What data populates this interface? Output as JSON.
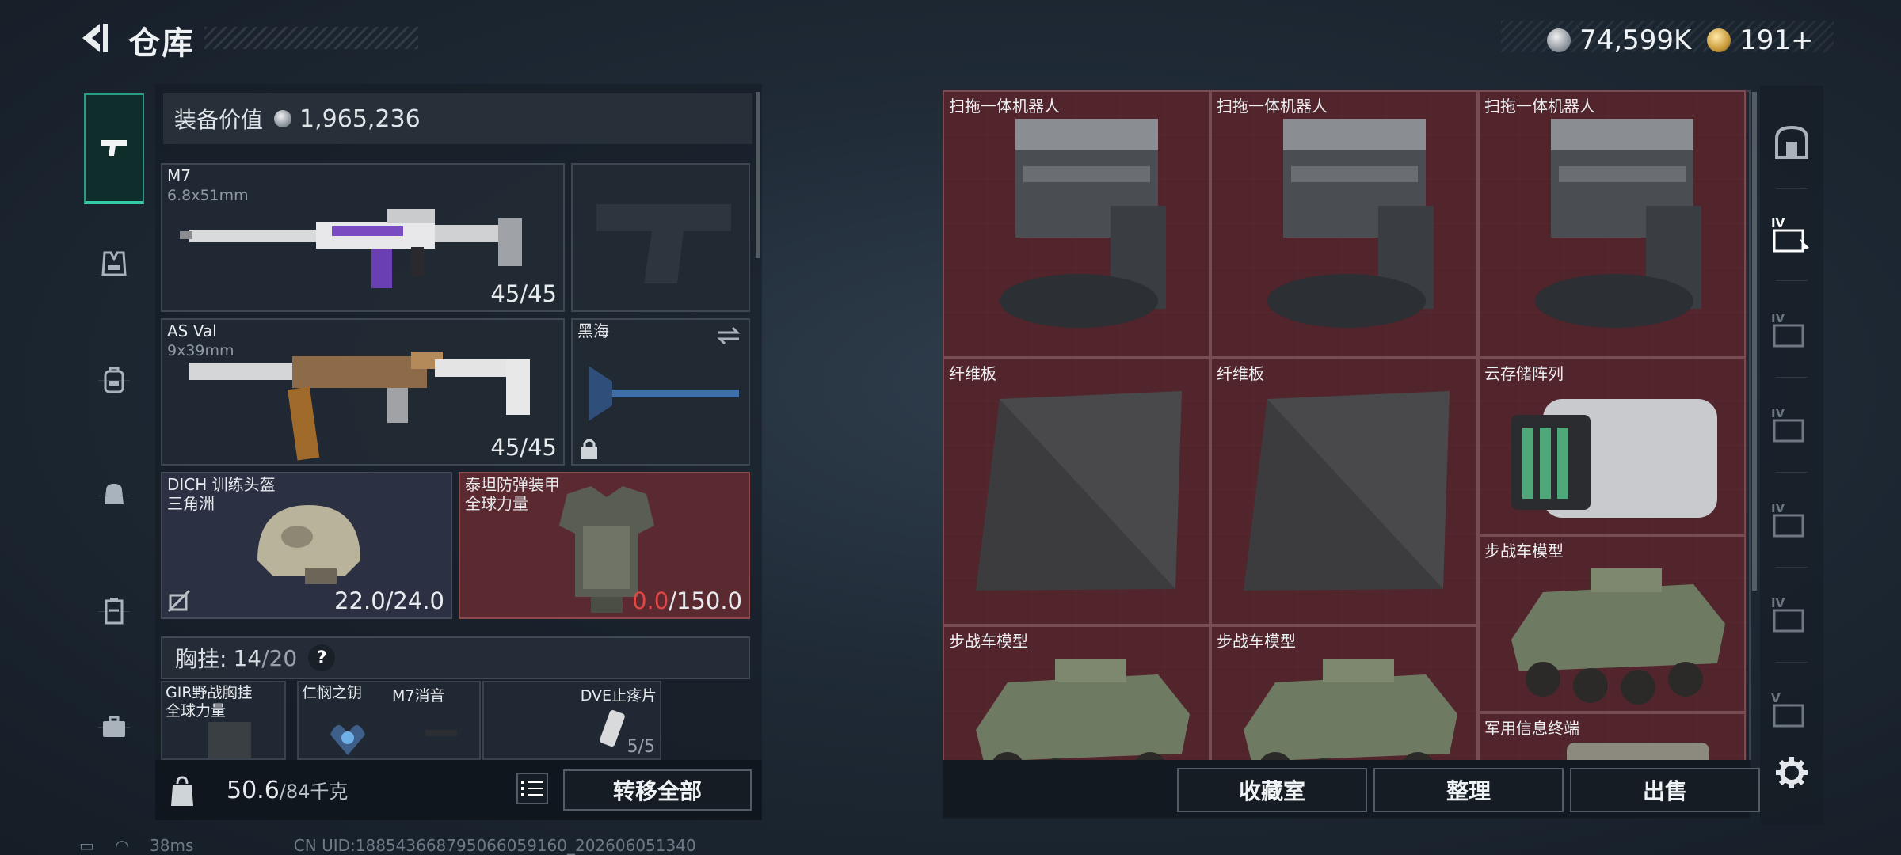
{
  "header": {
    "title": "仓库",
    "currency": [
      {
        "icon": "silver-coin-icon",
        "value": "74,599K"
      },
      {
        "icon": "gold-coin-icon",
        "value": "191+"
      }
    ]
  },
  "left_nav": [
    {
      "icon": "pistol-icon",
      "active": true
    },
    {
      "icon": "vest-icon",
      "active": false
    },
    {
      "icon": "backpack-icon",
      "active": false
    },
    {
      "icon": "bag-icon",
      "active": false
    },
    {
      "icon": "clipboard-icon",
      "active": false
    },
    {
      "icon": "briefcase-icon",
      "active": false
    }
  ],
  "equipment": {
    "value_label": "装备价值",
    "value": "1,965,236",
    "primary1": {
      "name": "M7",
      "caliber": "6.8x51mm",
      "ammo": "45/45"
    },
    "primary2": {
      "name": "AS Val",
      "caliber": "9x39mm",
      "ammo": "45/45"
    },
    "melee": {
      "name": "黑海"
    },
    "helmet": {
      "name": "DICH 训练头盔",
      "maker": "三角洲",
      "durability": "22.0/24.0"
    },
    "armor": {
      "name": "泰坦防弹装甲",
      "maker": "全球力量",
      "durability_current": "0.0",
      "durability_max": "/150.0"
    }
  },
  "chest_rig": {
    "label": "胸挂:",
    "current": "14",
    "max": "/20",
    "help": "?",
    "items": [
      {
        "name": "GIR野战胸挂",
        "maker": "全球力量"
      },
      {
        "name": "仁悯之钥"
      },
      {
        "name": "M7消音"
      },
      {
        "name": "DVE止疼片",
        "count": "5/5"
      }
    ]
  },
  "bottom_bar": {
    "weight": "50.6",
    "weight_max": "/84千克",
    "transfer_all": "转移全部"
  },
  "storage": {
    "items": [
      {
        "name": "扫拖一体机器人"
      },
      {
        "name": "扫拖一体机器人"
      },
      {
        "name": "扫拖一体机器人"
      },
      {
        "name": "纤维板"
      },
      {
        "name": "纤维板"
      },
      {
        "name": "云存储阵列"
      },
      {
        "name": "步战车模型"
      },
      {
        "name": "步战车模型"
      },
      {
        "name": "步战车模型"
      },
      {
        "name": "军用信息终端"
      }
    ],
    "buttons": {
      "collection": "收藏室",
      "organize": "整理",
      "sell": "出售"
    }
  },
  "right_nav": [
    {
      "icon": "safe-box-icon",
      "label": ""
    },
    {
      "icon": "storage-tier-icon",
      "label": "IV"
    },
    {
      "icon": "storage-tier-icon",
      "label": "IV"
    },
    {
      "icon": "storage-tier-icon",
      "label": "IV"
    },
    {
      "icon": "storage-tier-icon",
      "label": "IV"
    },
    {
      "icon": "storage-tier-icon",
      "label": "IV"
    },
    {
      "icon": "storage-tier-icon",
      "label": "V"
    },
    {
      "icon": "gear-icon",
      "label": ""
    }
  ],
  "status_bar": {
    "ping": "38ms",
    "uid": "CN UID:1885436687950660591​60_202606051340"
  },
  "colors": {
    "accent": "#36c9a7",
    "red_cell": "#5a2a30",
    "damage": "#e24646"
  }
}
